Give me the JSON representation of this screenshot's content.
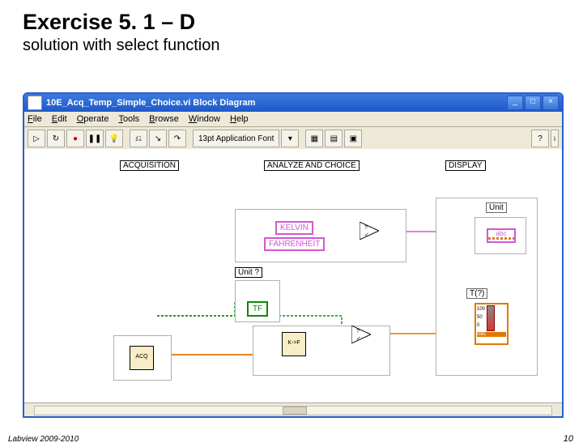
{
  "slide": {
    "title": "Exercise 5. 1 – D",
    "subtitle": "solution with select function",
    "footer_left": "Labview 2009-2010",
    "footer_right": "10"
  },
  "window": {
    "title": "10E_Acq_Temp_Simple_Choice.vi Block Diagram",
    "menu": {
      "file": "File",
      "edit": "Edit",
      "operate": "Operate",
      "tools": "Tools",
      "browse": "Browse",
      "window": "Window",
      "help": "Help"
    },
    "toolbar": {
      "font": "13pt Application Font"
    }
  },
  "diagram": {
    "labels": {
      "acq": "ACQUISITION",
      "analyze": "ANALYZE AND CHOICE",
      "display": "DISPLAY",
      "unitq": "Unit ?",
      "unit": "Unit",
      "tq": "T(?)"
    },
    "nodes": {
      "kelvin": "KELVIN",
      "fahrenheit": "FAHRENHEIT",
      "tf": "TF",
      "abc": "abc"
    },
    "subvi": {
      "acq": "ACQ",
      "ktof": "K->F"
    },
    "thermo": {
      "a": "100",
      "b": "50",
      "c": "0",
      "d": "DBL"
    }
  }
}
